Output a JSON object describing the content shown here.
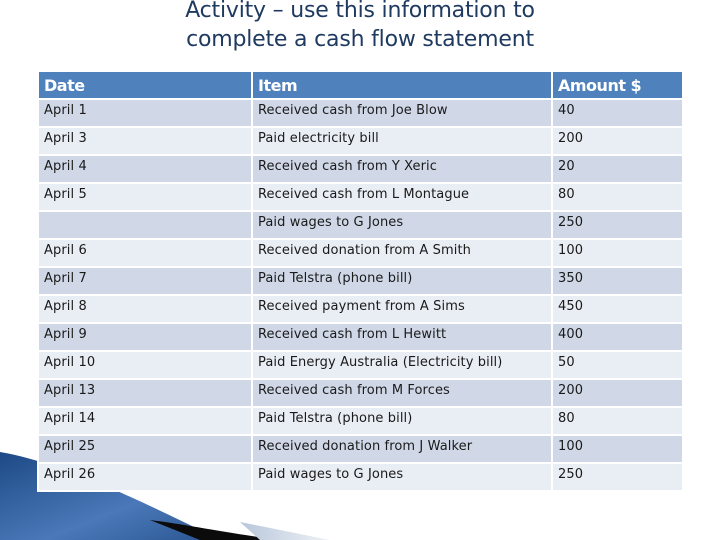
{
  "slide": {
    "title_line1": "Activity – use this information to",
    "title_line2": "complete a cash flow statement"
  },
  "table": {
    "headers": [
      "Date",
      "Item",
      "Amount $"
    ],
    "rows": [
      {
        "date": "April 1",
        "item": "Received cash from Joe Blow",
        "amount": "40"
      },
      {
        "date": "April 3",
        "item": "Paid electricity bill",
        "amount": "200"
      },
      {
        "date": "April 4",
        "item": "Received cash from Y Xeric",
        "amount": "20"
      },
      {
        "date": "April 5",
        "item": "Received cash from L Montague",
        "amount": "80"
      },
      {
        "date": "",
        "item": "Paid wages to G Jones",
        "amount": "250"
      },
      {
        "date": "April 6",
        "item": "Received donation from A Smith",
        "amount": "100"
      },
      {
        "date": "April 7",
        "item": "Paid Telstra (phone bill)",
        "amount": "350"
      },
      {
        "date": "April 8",
        "item": "Received payment from A Sims",
        "amount": "450"
      },
      {
        "date": "April 9",
        "item": "Received cash from L Hewitt",
        "amount": "400"
      },
      {
        "date": "April 10",
        "item": "Paid Energy Australia (Electricity bill)",
        "amount": "50"
      },
      {
        "date": "April 13",
        "item": "Received cash from M Forces",
        "amount": "200"
      },
      {
        "date": "April 14",
        "item": "Paid Telstra (phone bill)",
        "amount": "80"
      },
      {
        "date": "April 25",
        "item": "Received donation from J Walker",
        "amount": "100"
      },
      {
        "date": "April 26",
        "item": "Paid wages to G Jones",
        "amount": "250"
      }
    ]
  },
  "colors": {
    "title": "#1f3a60",
    "header_bg": "#4f81bd",
    "row_odd_bg": "#d0d8e8",
    "row_even_bg": "#e9edf4"
  }
}
